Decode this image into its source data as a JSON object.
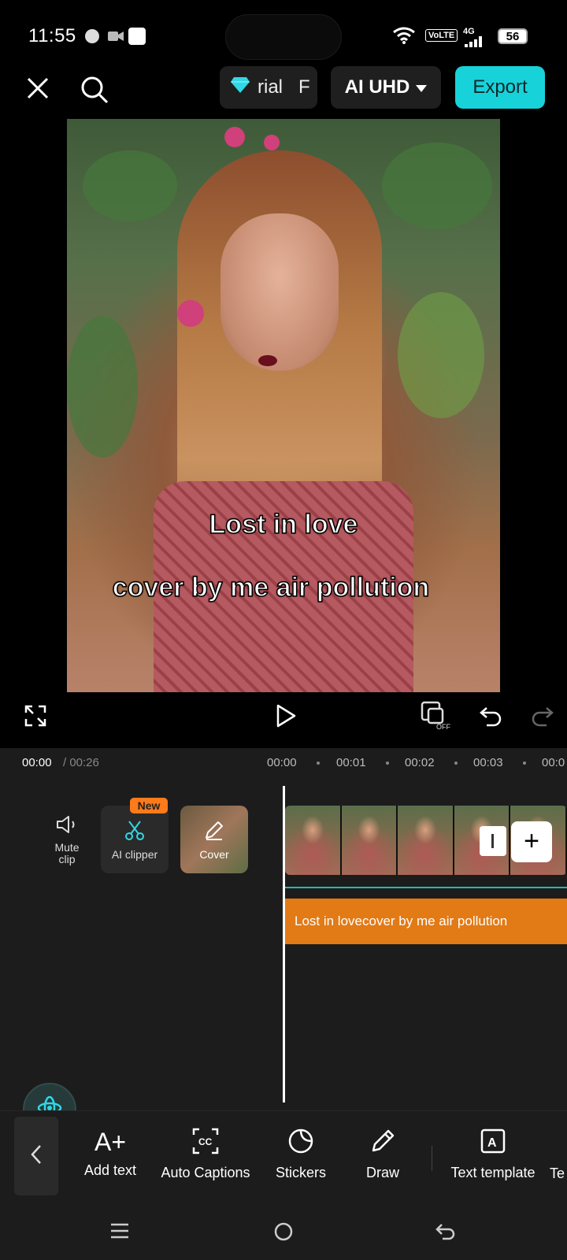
{
  "status_bar": {
    "time": "11:55",
    "volte": "VoLTE",
    "network": "4G",
    "battery": "56"
  },
  "toolbar": {
    "close_icon": "close-icon",
    "search_icon": "search-icon",
    "trial_label": "rial   F",
    "quality_label": "AI UHD",
    "export_label": "Export"
  },
  "preview": {
    "caption_1": "Lost in love",
    "caption_2": "cover by me air pollution"
  },
  "player": {
    "fullscreen_icon": "fullscreen-icon",
    "play_icon": "play-icon",
    "keyframe_off_icon": "keyframe-off-icon",
    "undo_icon": "undo-icon",
    "redo_icon": "redo-icon"
  },
  "timeline": {
    "current_time": "00:00",
    "total_time": "/ 00:26",
    "ruler": [
      "00:00",
      "00:01",
      "00:02",
      "00:03",
      "00:0"
    ],
    "mute_label": "Mute\nclip",
    "ai_clipper_label": "AI clipper",
    "new_badge": "New",
    "cover_label": "Cover",
    "text_track": "Lost in lovecover by me air pollution"
  },
  "bottom_tools": [
    {
      "label": "Add text",
      "icon": "add-text-icon"
    },
    {
      "label": "Auto Captions",
      "icon": "captions-icon"
    },
    {
      "label": "Stickers",
      "icon": "sticker-icon"
    },
    {
      "label": "Draw",
      "icon": "pencil-icon"
    },
    {
      "label": "Text template",
      "icon": "text-template-icon"
    },
    {
      "label": "Te",
      "icon": "text-icon"
    }
  ],
  "colors": {
    "accent": "#18d2da",
    "badge": "#ff7a1a",
    "text_track": "#e27a16"
  }
}
